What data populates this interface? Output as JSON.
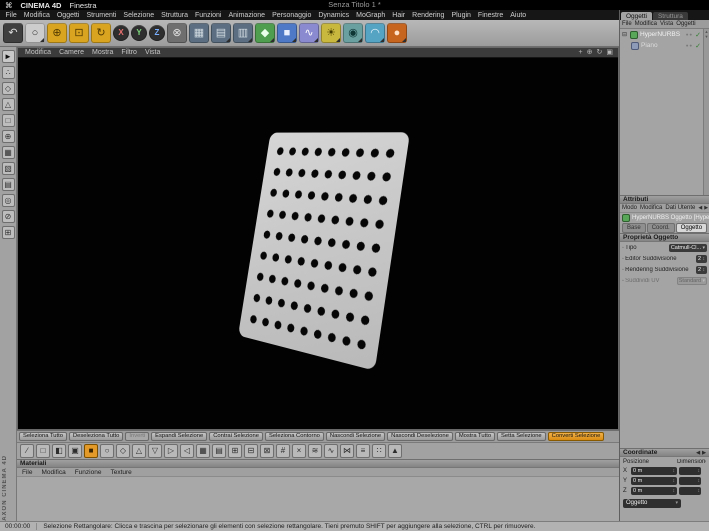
{
  "macos_bar": {
    "app_name": "CINEMA 4D",
    "window_menu": "Finestra",
    "window_title": "Senza Titolo 1 *"
  },
  "menu_bar": {
    "items": [
      "File",
      "Modifica",
      "Oggetti",
      "Strumenti",
      "Selezione",
      "Struttura",
      "Funzioni",
      "Animazione",
      "Personaggio",
      "Dynamics",
      "MoGraph",
      "Hair",
      "Rendering",
      "Plugin",
      "Finestre",
      "Aiuto"
    ]
  },
  "toolbar": {
    "icons": [
      {
        "name": "undo-icon",
        "glyph": "↶",
        "color": "#3f3f3f",
        "fg": "#dddddd"
      },
      {
        "name": "live-selection-icon",
        "glyph": "○",
        "color": "#cccccc",
        "fg": "#333333",
        "menu": true
      },
      {
        "name": "move-icon",
        "glyph": "⊕",
        "color": "#d9a520",
        "fg": "#533a00"
      },
      {
        "name": "scale-icon",
        "glyph": "⊡",
        "color": "#d9a520",
        "fg": "#533a00"
      },
      {
        "name": "rotate-icon",
        "glyph": "↻",
        "color": "#d9a520",
        "fg": "#533a00"
      },
      {
        "name": "x-axis-lock-icon",
        "glyph": "X",
        "color": "#2e2e2e",
        "fg": "#e87070",
        "round": true
      },
      {
        "name": "y-axis-lock-icon",
        "glyph": "Y",
        "color": "#2e2e2e",
        "fg": "#7ed87e",
        "round": true
      },
      {
        "name": "z-axis-lock-icon",
        "glyph": "Z",
        "color": "#2e2e2e",
        "fg": "#7ab0ff",
        "round": true
      },
      {
        "name": "coordinate-system-icon",
        "glyph": "⊗",
        "color": "#6f6f6f",
        "fg": "#e0e0e0"
      },
      {
        "name": "render-view-icon",
        "glyph": "▦",
        "color": "#5c6f82",
        "fg": "#d2dbe2"
      },
      {
        "name": "render-settings-icon",
        "glyph": "▤",
        "color": "#5c6f82",
        "fg": "#d2dbe2",
        "menu": true
      },
      {
        "name": "render-picture-viewer-icon",
        "glyph": "▥",
        "color": "#5c6f82",
        "fg": "#d2dbe2",
        "menu": true
      },
      {
        "name": "add-hypernurbs-icon",
        "glyph": "◆",
        "color": "#4f9d4f",
        "fg": "#eaffea",
        "menu": true
      },
      {
        "name": "add-cube-icon",
        "glyph": "■",
        "color": "#4d79c7",
        "fg": "#e8f0ff",
        "menu": true
      },
      {
        "name": "add-spline-icon",
        "glyph": "∿",
        "color": "#8a8ad0",
        "fg": "#ffffff",
        "menu": true
      },
      {
        "name": "add-light-icon",
        "glyph": "☀",
        "color": "#c9b83e",
        "fg": "#443b00",
        "menu": true
      },
      {
        "name": "add-camera-icon",
        "glyph": "◉",
        "color": "#6aa0a0",
        "fg": "#0f3535",
        "menu": true
      },
      {
        "name": "add-environment-icon",
        "glyph": "◠",
        "color": "#56a4c4",
        "fg": "#eaf6ff",
        "menu": true
      },
      {
        "name": "add-material-icon",
        "glyph": "●",
        "color": "#c7641e",
        "fg": "#ffe2c8",
        "menu": true
      }
    ]
  },
  "left_toolbar": {
    "icons": [
      {
        "name": "cursor-tool-icon",
        "glyph": "►",
        "color": "#c8c8c8",
        "fg": "#111111"
      },
      {
        "name": "points-mode-icon",
        "glyph": "∴"
      },
      {
        "name": "edges-mode-icon",
        "glyph": "◇"
      },
      {
        "name": "polygons-mode-icon",
        "glyph": "△"
      },
      {
        "name": "model-mode-icon",
        "glyph": "□"
      },
      {
        "name": "object-axis-mode-icon",
        "glyph": "⊕"
      },
      {
        "name": "texture-mode-icon",
        "glyph": "▦"
      },
      {
        "name": "texture-axis-mode-icon",
        "glyph": "▧"
      },
      {
        "name": "workplane-mode-icon",
        "glyph": "▤"
      },
      {
        "name": "animation-mode-icon",
        "glyph": "◎"
      },
      {
        "name": "lock-mode-icon",
        "glyph": "⊘"
      },
      {
        "name": "snap-mode-icon",
        "glyph": "⊞"
      }
    ]
  },
  "brand": {
    "label": "MAXON CINEMA 4D"
  },
  "viewport": {
    "menu": [
      "Modifica",
      "Camere",
      "Mostra",
      "Filtro",
      "Vista"
    ]
  },
  "object_manager": {
    "tabs": [
      {
        "name": "tab-oggetti",
        "label": "Oggetti",
        "active": true
      },
      {
        "name": "tab-struttura",
        "label": "Struttura"
      }
    ],
    "menu": [
      "File",
      "Modifica",
      "Vista",
      "Oggetti"
    ],
    "objects": [
      {
        "label": "HyperNURBS"
      },
      {
        "label": "Piano"
      }
    ]
  },
  "attributes": {
    "title": "Attributi",
    "menu": [
      "Modo",
      "Modifica",
      "Dati Utente"
    ],
    "object_header": "HyperNURBS Oggetto [HyperNURBS]",
    "tabs": [
      {
        "name": "attr-tab-base",
        "label": "Base"
      },
      {
        "name": "attr-tab-coord",
        "label": "Coord."
      },
      {
        "name": "attr-tab-oggetto",
        "label": "Oggetto",
        "active": true
      }
    ],
    "section": "Proprietà Oggetto",
    "rows": [
      {
        "name": "tipo-dropdown",
        "label": "Tipo",
        "value": "Catmull-Cl...",
        "type": "dropdown"
      },
      {
        "name": "editor-suddivisione-field",
        "label": "Editor Suddivisione",
        "value": "2",
        "type": "stepper"
      },
      {
        "name": "rendering-suddivisione-field",
        "label": "Rendering Suddivisione",
        "value": "2",
        "type": "stepper"
      },
      {
        "name": "suddividi-uv-dropdown",
        "label": "Suddividi UV",
        "value": "Standard",
        "type": "dropdown",
        "disabled": true
      }
    ]
  },
  "coordinates": {
    "title": "Coordinate",
    "col_position": "Posizione",
    "col_size": "Dimensione",
    "rows": [
      {
        "axis": "X",
        "value": "0 m"
      },
      {
        "axis": "Y",
        "value": "0 m"
      },
      {
        "axis": "Z",
        "value": "0 m"
      }
    ],
    "mode": "Oggetto"
  },
  "selection_row": {
    "buttons": [
      {
        "label": "Seleziona Tutto"
      },
      {
        "label": "Deseleziona Tutto"
      },
      {
        "label": "Inverti",
        "disabled": true
      },
      {
        "label": "Espandi Selezione"
      },
      {
        "label": "Contrai Selezione"
      },
      {
        "label": "Seleziona Contorno"
      },
      {
        "label": "Nascondi Selezione"
      },
      {
        "label": "Nascondi Deselezione"
      },
      {
        "label": "Mostra Tutto"
      },
      {
        "label": "Setta Selezione"
      },
      {
        "label": "Converti Selezione",
        "highlight": true
      }
    ]
  },
  "bottom_toolbar": {
    "icons": [
      {
        "glyph": "∕"
      },
      {
        "glyph": "□"
      },
      {
        "glyph": "◧"
      },
      {
        "glyph": "▣"
      },
      {
        "glyph": "■",
        "highlight": true
      },
      {
        "glyph": "○"
      },
      {
        "glyph": "◇"
      },
      {
        "glyph": "△"
      },
      {
        "glyph": "▽"
      },
      {
        "glyph": "▷"
      },
      {
        "glyph": "◁"
      },
      {
        "glyph": "▦"
      },
      {
        "glyph": "▤"
      },
      {
        "glyph": "⊞"
      },
      {
        "glyph": "⊟"
      },
      {
        "glyph": "⊠"
      },
      {
        "glyph": "#"
      },
      {
        "glyph": "×"
      },
      {
        "glyph": "≋"
      },
      {
        "glyph": "∿"
      },
      {
        "glyph": "⋈"
      },
      {
        "glyph": "≡"
      },
      {
        "glyph": "∷"
      },
      {
        "glyph": "▲"
      }
    ]
  },
  "materials": {
    "title": "Materiali",
    "menu": [
      "File",
      "Modifica",
      "Funzione",
      "Texture"
    ]
  },
  "status_bar": {
    "time": "00:00:00",
    "message": "Selezione Rettangolare: Clicca e trascina per selezionare gli elementi con selezione rettangolare. Tieni premuto SHIFT per aggiungere alla selezione, CTRL per rimuovere."
  }
}
